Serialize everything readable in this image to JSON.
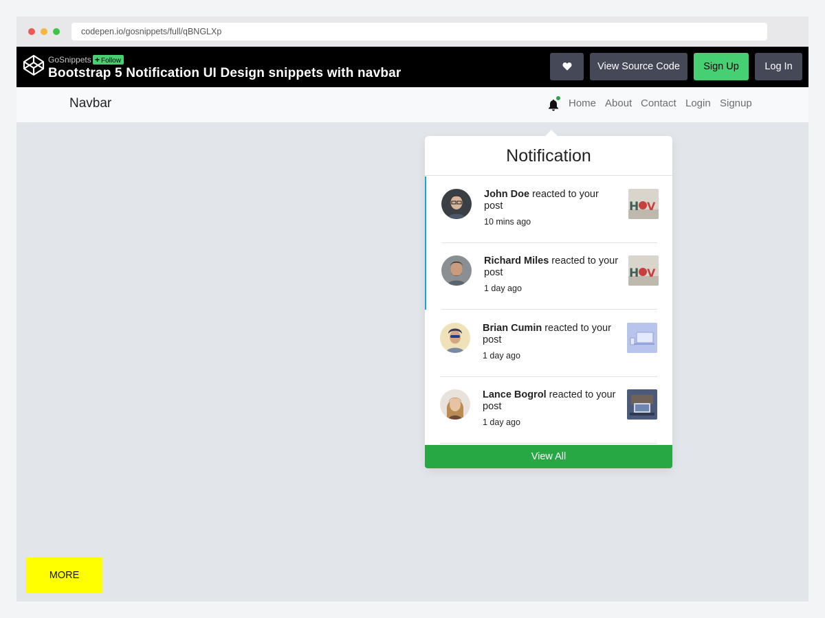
{
  "browser": {
    "url": "codepen.io/gosnippets/full/qBNGLXp"
  },
  "codepen": {
    "owner": "GoSnippets",
    "follow_label": "Follow",
    "title": "Bootstrap 5 Notification UI Design snippets with navbar",
    "heart_icon": "heart-icon",
    "view_source_label": "View Source Code",
    "signup_label": "Sign Up",
    "login_label": "Log In"
  },
  "navbar": {
    "brand": "Navbar",
    "links": [
      "Home",
      "About",
      "Contact",
      "Login",
      "Signup"
    ],
    "bell_icon": "bell-icon"
  },
  "notifications": {
    "title": "Notification",
    "items": [
      {
        "name": "John Doe",
        "action": " reacted to your post",
        "time": "10 mins ago",
        "unread": true
      },
      {
        "name": "Richard Miles",
        "action": " reacted to your post",
        "time": "1 day ago",
        "unread": true
      },
      {
        "name": "Brian Cumin",
        "action": " reacted to your post",
        "time": "1 day ago",
        "unread": false
      },
      {
        "name": "Lance Bogrol",
        "action": " reacted to your post",
        "time": "1 day ago",
        "unread": false
      }
    ],
    "view_all_label": "View All"
  },
  "more_label": "MORE",
  "colors": {
    "accent_green": "#28a745",
    "codepen_green": "#47cf73",
    "unread_bar": "#17a2e0",
    "more_yellow": "#ffff00"
  }
}
